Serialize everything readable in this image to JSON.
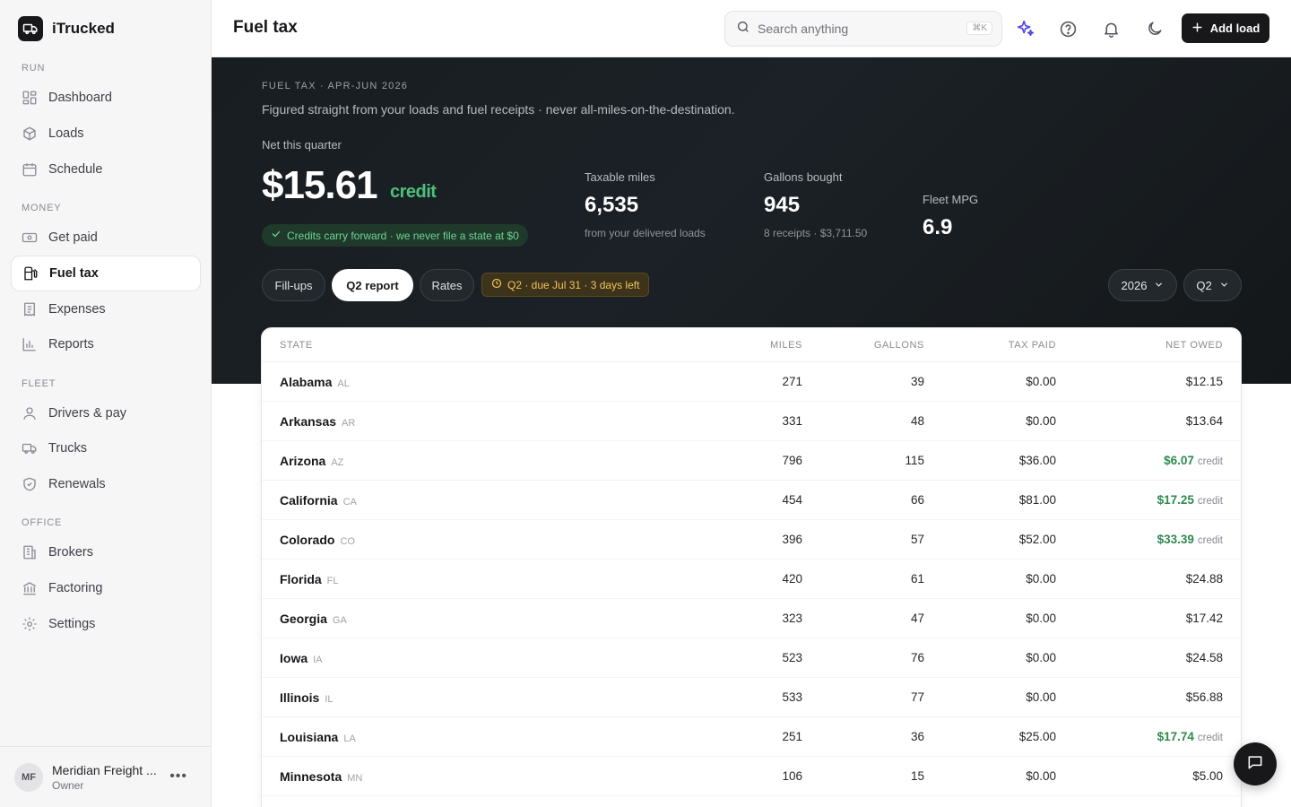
{
  "app": {
    "name": "iTrucked"
  },
  "sidebar": {
    "sections": [
      {
        "label": "RUN"
      },
      {
        "label": "MONEY"
      },
      {
        "label": "FLEET"
      },
      {
        "label": "OFFICE"
      }
    ],
    "items": [
      {
        "label": "Dashboard",
        "icon": "dashboard-icon"
      },
      {
        "label": "Loads",
        "icon": "box-icon"
      },
      {
        "label": "Schedule",
        "icon": "calendar-icon"
      },
      {
        "label": "Get paid",
        "icon": "banknote-icon"
      },
      {
        "label": "Fuel tax",
        "icon": "fuel-icon",
        "active": true
      },
      {
        "label": "Expenses",
        "icon": "receipt-icon"
      },
      {
        "label": "Reports",
        "icon": "bar-chart-icon"
      },
      {
        "label": "Drivers & pay",
        "icon": "user-icon"
      },
      {
        "label": "Trucks",
        "icon": "truck-icon"
      },
      {
        "label": "Renewals",
        "icon": "shield-icon"
      },
      {
        "label": "Brokers",
        "icon": "building-icon"
      },
      {
        "label": "Factoring",
        "icon": "bank-icon"
      },
      {
        "label": "Settings",
        "icon": "gear-icon"
      }
    ],
    "footer": {
      "initials": "MF",
      "org": "Meridian Freight ...",
      "role": "Owner"
    }
  },
  "header": {
    "title": "Fuel tax",
    "search_placeholder": "Search anything",
    "search_shortcut": "⌘K",
    "add_load_label": "Add load"
  },
  "hero": {
    "eyebrow": "FUEL TAX · APR-JUN 2026",
    "subtitle": "Figured straight from your loads and fuel receipts · never all-miles-on-the-destination.",
    "net_label": "Net this quarter",
    "net_value": "$15.61",
    "net_tag": "credit",
    "carry_note": "Credits carry forward · we never file a state at $0",
    "stats": [
      {
        "label": "Taxable miles",
        "value": "6,535",
        "note": "from your delivered loads"
      },
      {
        "label": "Gallons bought",
        "value": "945",
        "note": "8 receipts · $3,711.50"
      },
      {
        "label": "Fleet MPG",
        "value": "6.9",
        "note": ""
      }
    ],
    "tabs": [
      "Fill-ups",
      "Q2 report",
      "Rates"
    ],
    "active_tab": "Q2 report",
    "due_note": "Q2 · due Jul 31 · 3 days left",
    "year_select": "2026",
    "quarter_select": "Q2"
  },
  "table": {
    "columns": [
      "STATE",
      "MILES",
      "GALLONS",
      "TAX PAID",
      "NET OWED"
    ],
    "credit_word": "credit",
    "rows": [
      {
        "state": "Alabama",
        "abbr": "AL",
        "miles": "271",
        "gallons": "39",
        "tax_paid": "$0.00",
        "net": "$12.15",
        "credit": false
      },
      {
        "state": "Arkansas",
        "abbr": "AR",
        "miles": "331",
        "gallons": "48",
        "tax_paid": "$0.00",
        "net": "$13.64",
        "credit": false
      },
      {
        "state": "Arizona",
        "abbr": "AZ",
        "miles": "796",
        "gallons": "115",
        "tax_paid": "$36.00",
        "net": "$6.07",
        "credit": true
      },
      {
        "state": "California",
        "abbr": "CA",
        "miles": "454",
        "gallons": "66",
        "tax_paid": "$81.00",
        "net": "$17.25",
        "credit": true
      },
      {
        "state": "Colorado",
        "abbr": "CO",
        "miles": "396",
        "gallons": "57",
        "tax_paid": "$52.00",
        "net": "$33.39",
        "credit": true
      },
      {
        "state": "Florida",
        "abbr": "FL",
        "miles": "420",
        "gallons": "61",
        "tax_paid": "$0.00",
        "net": "$24.88",
        "credit": false
      },
      {
        "state": "Georgia",
        "abbr": "GA",
        "miles": "323",
        "gallons": "47",
        "tax_paid": "$0.00",
        "net": "$17.42",
        "credit": false
      },
      {
        "state": "Iowa",
        "abbr": "IA",
        "miles": "523",
        "gallons": "76",
        "tax_paid": "$0.00",
        "net": "$24.58",
        "credit": false
      },
      {
        "state": "Illinois",
        "abbr": "IL",
        "miles": "533",
        "gallons": "77",
        "tax_paid": "$0.00",
        "net": "$56.88",
        "credit": false
      },
      {
        "state": "Louisiana",
        "abbr": "LA",
        "miles": "251",
        "gallons": "36",
        "tax_paid": "$25.00",
        "net": "$17.74",
        "credit": true
      },
      {
        "state": "Minnesota",
        "abbr": "MN",
        "miles": "106",
        "gallons": "15",
        "tax_paid": "$0.00",
        "net": "$5.00",
        "credit": false
      }
    ]
  },
  "colors": {
    "accent": "#18181b",
    "credit_green": "#2e8a4e",
    "hero_bg": "#1b2126",
    "due_amber": "#f1c45a"
  }
}
